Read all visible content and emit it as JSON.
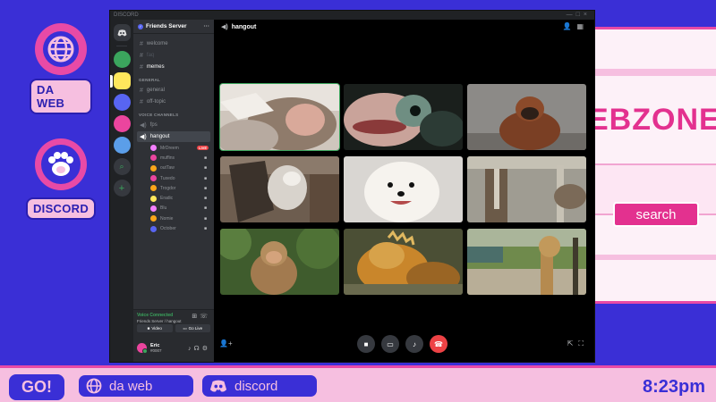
{
  "desktop": {
    "icons": [
      {
        "label": "DA WEB"
      },
      {
        "label": "DISCORD"
      }
    ]
  },
  "bg_browser": {
    "brand_text": "EBZONE",
    "search_label": "search"
  },
  "window": {
    "title": "DISCORD"
  },
  "server": {
    "name": "Friends Server",
    "channels": [
      {
        "name": "welcome",
        "state": "normal"
      },
      {
        "name": "faq",
        "state": "muted"
      },
      {
        "name": "memes",
        "state": "unread"
      }
    ],
    "categories": {
      "general": "GENERAL",
      "voice": "VOICE CHANNELS"
    },
    "general_channels": [
      {
        "name": "general"
      },
      {
        "name": "off-topic"
      }
    ],
    "voice_channels": [
      {
        "name": "fps"
      },
      {
        "name": "hangout"
      }
    ],
    "members": [
      {
        "name": "MrDreem",
        "color": "#f47fff",
        "badge": "LIVE"
      },
      {
        "name": "muffins",
        "color": "#eb459e",
        "badge": "cam"
      },
      {
        "name": "outTaw",
        "color": "#faa61a",
        "badge": "cam"
      },
      {
        "name": "Tuxedo",
        "color": "#eb459e",
        "badge": "cam"
      },
      {
        "name": "Trogdor",
        "color": "#faa61a",
        "badge": "cam"
      },
      {
        "name": "Eradic",
        "color": "#fee75c",
        "badge": "cam"
      },
      {
        "name": "Blu",
        "color": "#f47fff",
        "badge": "cam"
      },
      {
        "name": "Nomie",
        "color": "#faa61a",
        "badge": "cam"
      },
      {
        "name": "October",
        "color": "#5865f2",
        "badge": "cam"
      }
    ]
  },
  "voice_panel": {
    "status": "Voice Connected",
    "location": "Friends Server / hangout",
    "video_label": "Video",
    "golive_label": "Go Live"
  },
  "user": {
    "name": "Eric",
    "tag": "#0007"
  },
  "call": {
    "channel_name": "hangout"
  },
  "taskbar": {
    "go_label": "GO!",
    "tasks": [
      {
        "label": "da web"
      },
      {
        "label": "discord"
      }
    ],
    "clock": "8:23pm"
  },
  "colors": {
    "desktop_bg": "#3a2fd6",
    "accent_pink": "#e84aa6",
    "taskbar_bg": "#f6bfe0",
    "discord_bg": "#202225",
    "sidebar_bg": "#2f3136",
    "voice_green": "#3ba55d",
    "hangup_red": "#ed4245"
  }
}
